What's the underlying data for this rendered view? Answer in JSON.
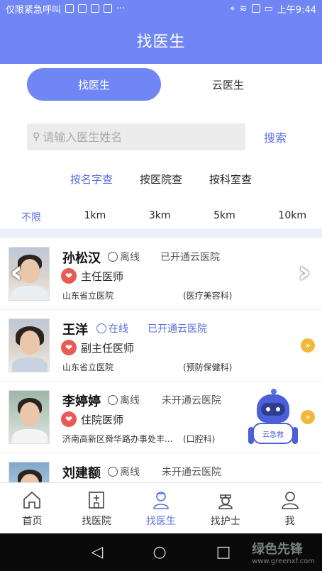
{
  "status_bar": {
    "left_text": "仅限紧急呼叫",
    "time": "上午9:44"
  },
  "header": {
    "title": "找医生"
  },
  "segment": {
    "tabs": [
      {
        "label": "找医生"
      },
      {
        "label": "云医生"
      }
    ]
  },
  "search": {
    "placeholder": "请输入医生姓名",
    "button": "搜索"
  },
  "filters": [
    "按名字查",
    "按医院查",
    "按科室查"
  ],
  "distances": [
    "不限",
    "1km",
    "3km",
    "5km",
    "10km"
  ],
  "doctors": [
    {
      "name": "孙松汉",
      "status": "离线",
      "cloud": "已开通云医院",
      "title": "主任医师",
      "hospital": "山东省立医院",
      "dept": "(医疗美容科)"
    },
    {
      "name": "王洋",
      "status": "在线",
      "cloud": "已开通云医院",
      "title": "副主任医师",
      "hospital": "山东省立医院",
      "dept": "(预防保健科)"
    },
    {
      "name": "李婷婷",
      "status": "离线",
      "cloud": "未开通云医院",
      "title": "住院医师",
      "hospital": "济南高新区舜华路办事处丰...",
      "dept": "(口腔科)"
    },
    {
      "name": "刘建额",
      "status": "离线",
      "cloud": "未开通云医院",
      "title": "",
      "hospital": "",
      "dept": ""
    }
  ],
  "robot": {
    "label": "云急救"
  },
  "tabbar": [
    {
      "label": "首页",
      "icon": "home-icon"
    },
    {
      "label": "找医院",
      "icon": "hospital-icon"
    },
    {
      "label": "找医生",
      "icon": "doctor-icon"
    },
    {
      "label": "找护士",
      "icon": "nurse-icon"
    },
    {
      "label": "我",
      "icon": "profile-icon"
    }
  ],
  "watermark": {
    "text": "绿色先锋",
    "url": "www.greenxf.com"
  },
  "colors": {
    "primary": "#6f86f4",
    "accent_text": "#5b6fe0",
    "heart": "#ea5a52",
    "more": "#f1b93c"
  }
}
